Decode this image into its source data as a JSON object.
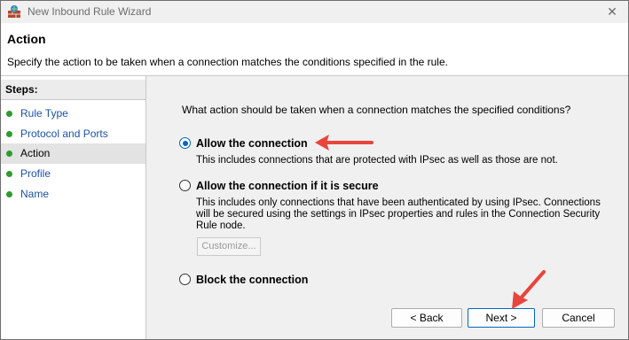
{
  "window": {
    "title": "New Inbound Rule Wizard",
    "close_glyph": "✕"
  },
  "header": {
    "title": "Action",
    "description": "Specify the action to be taken when a connection matches the conditions specified in the rule."
  },
  "steps": {
    "heading": "Steps:",
    "items": [
      {
        "label": "Rule Type"
      },
      {
        "label": "Protocol and Ports"
      },
      {
        "label": "Action"
      },
      {
        "label": "Profile"
      },
      {
        "label": "Name"
      }
    ],
    "active_index": 2
  },
  "main": {
    "question": "What action should be taken when a connection matches the specified conditions?",
    "options": [
      {
        "label": "Allow the connection",
        "desc_lines": [
          "This includes connections that are protected with IPsec as well as those are not."
        ],
        "selected": true
      },
      {
        "label": "Allow the connection if it is secure",
        "desc_lines": [
          "This includes only connections that have been authenticated by using IPsec.  Connections",
          "will be secured using the settings in IPsec properties and rules in the Connection Security",
          "Rule node."
        ],
        "selected": false
      },
      {
        "label": "Block the connection",
        "desc_lines": [],
        "selected": false
      }
    ],
    "customize_label": "Customize..."
  },
  "footer": {
    "back_label": "< Back",
    "next_label": "Next >",
    "cancel_label": "Cancel"
  },
  "colors": {
    "accent": "#0067c0",
    "annotation_arrow": "#e8453c",
    "step_dot": "#2e9b2e"
  }
}
